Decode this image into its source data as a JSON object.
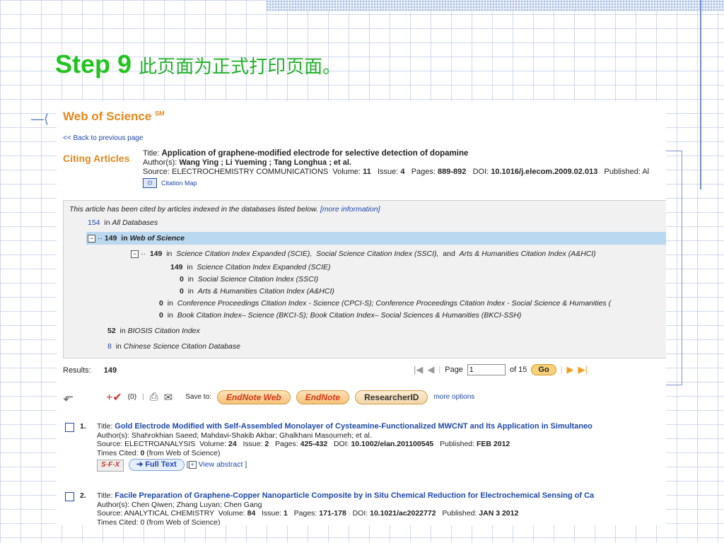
{
  "slide": {
    "step": "Step 9",
    "caption": "此页面为正式打印页面。"
  },
  "header": {
    "brand": "Web of Science",
    "brand_sup": "SM",
    "back_link": "<< Back to previous page",
    "section": "Citing Articles"
  },
  "article": {
    "title_label": "Title:",
    "title": "Application of graphene-modified electrode for selective detection of dopamine",
    "authors_label": "Author(s):",
    "authors": "Wang Ying ; Li Yueming ; Tang Longhua ; et al.",
    "source_label": "Source:",
    "source": "ELECTROCHEMISTRY COMMUNICATIONS",
    "volume_label": "Volume:",
    "volume": "11",
    "issue_label": "Issue:",
    "issue": "4",
    "pages_label": "Pages:",
    "pages": "889-892",
    "doi_label": "DOI:",
    "doi": "10.1016/j.elecom.2009.02.013",
    "published_label": "Published: Al",
    "citation_map": "Citation Map"
  },
  "databases": {
    "intro": "This article has been cited by articles indexed in the databases listed below.",
    "more_info": "[more information]",
    "all_count": "154",
    "all_label": "All Databases",
    "wos_count": "149",
    "wos_label": "Web of Science",
    "sub_count": "149",
    "sub_label_1": "Science Citation Index Expanded (SCIE),",
    "sub_label_2": "Social Science Citation Index (SSCI),",
    "and_text": "and",
    "sub_label_3": "Arts & Humanities Citation Index (A&HCI)",
    "scie_count": "149",
    "scie_label": "Science Citation Index Expanded (SCIE)",
    "ssci_count": "0",
    "ssci_label": "Social Science Citation Index (SSCI)",
    "ahci_count": "0",
    "ahci_label": "Arts & Humanities Citation Index (A&HCI)",
    "cpci_count": "0",
    "cpci_label": "Conference Proceedings Citation Index - Science (CPCI-S);  Conference Proceedings Citation Index - Social Science & Humanities (",
    "bkci_count": "0",
    "bkci_label": "Book Citation Index– Science (BKCI-S);  Book Citation Index– Social Sciences & Humanities (BKCI-SSH)",
    "biosis_count": "52",
    "biosis_label": "BIOSIS Citation Index",
    "cscd_count": "8",
    "cscd_label": "Chinese Science Citation Database",
    "in_word": "in"
  },
  "results": {
    "label": "Results:",
    "count": "149",
    "page_label": "Page",
    "page_value": "1",
    "of_pages": "of 15",
    "go": "Go"
  },
  "toolbar": {
    "marked": "(0)",
    "save_to": "Save to:",
    "endnote_web": "EndNote Web",
    "endnote": "EndNote",
    "researcherid": "ResearcherID",
    "more_options": "more options"
  },
  "records": [
    {
      "num": "1.",
      "title_label": "Title:",
      "title": "Gold Electrode Modified with Self-Assembled Monolayer of Cysteamine-Functionalized MWCNT and Its Application in Simultaneo",
      "authors_label": "Author(s):",
      "authors": "Shahrokhian Saeed; Mahdavi-Shakib Akbar; Ghalkhani Masoumeh; et al.",
      "source_label": "Source:",
      "source": "ELECTROANALYSIS",
      "volume": "24",
      "issue": "2",
      "pages": "425-432",
      "doi": "10.1002/elan.201100545",
      "published": "FEB 2012",
      "times_cited_label": "Times Cited:",
      "times_cited": "0",
      "times_cited_src": "(from Web of Science)",
      "sfx": "S·F·X",
      "full_text": "Full Text",
      "view_abstract": "View abstract ]"
    },
    {
      "num": "2.",
      "title_label": "Title:",
      "title": "Facile Preparation of Graphene-Copper Nanoparticle Composite by in Situ Chemical Reduction for Electrochemical Sensing of Ca",
      "authors_label": "Author(s):",
      "authors": "Chen Qiwen; Zhang Luyan; Chen Gang",
      "source_label": "Source:",
      "source": "ANALYTICAL CHEMISTRY",
      "volume": "84",
      "issue": "1",
      "pages": "171-178",
      "doi": "10.1021/ac2022772",
      "published": "JAN 3 2012",
      "times_cited_partial": "Times Cited: 0 (from Web of Science)"
    }
  ],
  "labels": {
    "volume": "Volume:",
    "issue": "Issue:",
    "pages": "Pages:",
    "doi": "DOI:",
    "published": "Published:"
  }
}
